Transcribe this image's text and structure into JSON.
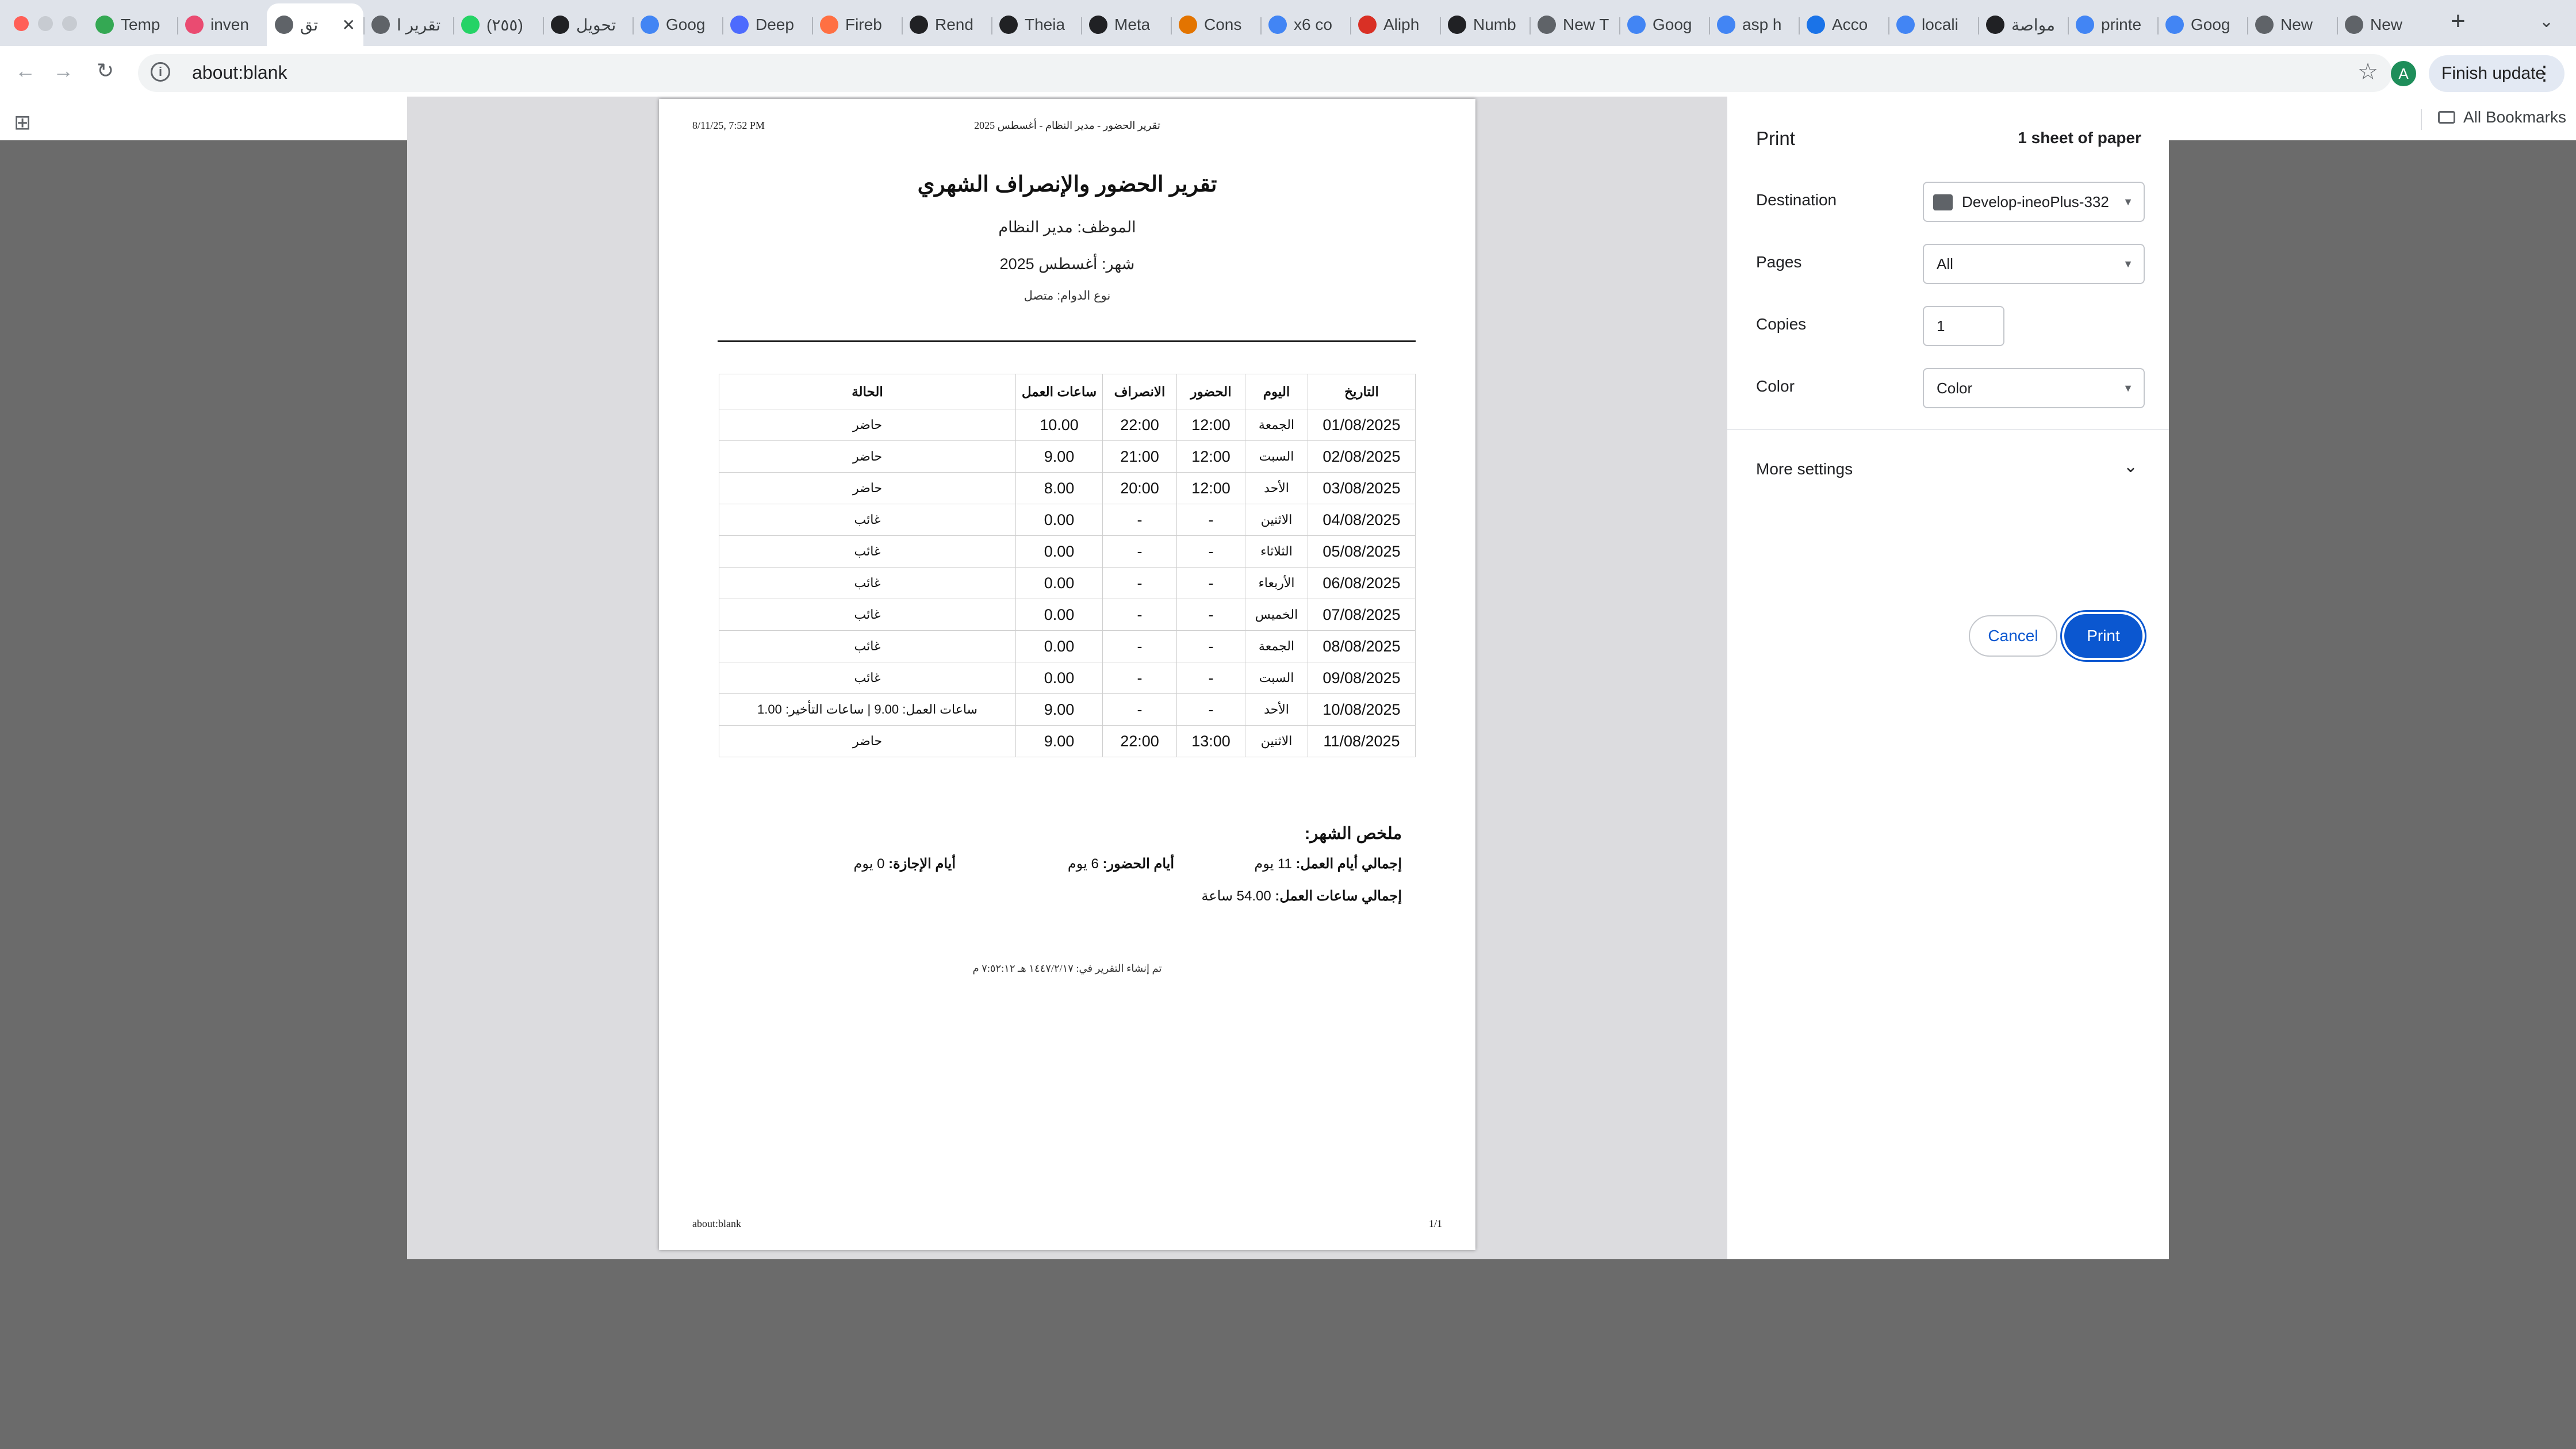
{
  "tabs": [
    {
      "label": "Temp",
      "icon": "shield-icon",
      "color": "#34a853"
    },
    {
      "label": "inven",
      "icon": "n8n-icon",
      "color": "#ea4b71"
    },
    {
      "label": "تق",
      "icon": "globe-icon",
      "color": "#5f6368",
      "active": true
    },
    {
      "label": "تقرير ا",
      "icon": "globe-icon",
      "color": "#5f6368"
    },
    {
      "label": "(٢٥٥)",
      "icon": "whatsapp-icon",
      "color": "#25d366"
    },
    {
      "label": "تحويل",
      "icon": "openai-icon",
      "color": "#202124"
    },
    {
      "label": "Goog",
      "icon": "gemini-icon",
      "color": "#4285f4"
    },
    {
      "label": "Deep",
      "icon": "deepseek-icon",
      "color": "#4d6bfe"
    },
    {
      "label": "Fireb",
      "icon": "firebase-icon",
      "color": "#ff7043"
    },
    {
      "label": "Rend",
      "icon": "render-icon",
      "color": "#202124"
    },
    {
      "label": "Theia",
      "icon": "theia-icon",
      "color": "#202124"
    },
    {
      "label": "Meta",
      "icon": "openai-icon",
      "color": "#202124"
    },
    {
      "label": "Cons",
      "icon": "console-icon",
      "color": "#e37400"
    },
    {
      "label": "x6 co",
      "icon": "google-icon",
      "color": "#4285f4"
    },
    {
      "label": "Aliph",
      "icon": "doc-icon",
      "color": "#d93025"
    },
    {
      "label": "Numb",
      "icon": "openai-icon",
      "color": "#202124"
    },
    {
      "label": "New T",
      "icon": "chrome-icon",
      "color": "#5f6368"
    },
    {
      "label": "Goog",
      "icon": "gemini-icon",
      "color": "#4285f4"
    },
    {
      "label": "asp h",
      "icon": "google-icon",
      "color": "#4285f4"
    },
    {
      "label": "Acco",
      "icon": "account-icon",
      "color": "#1a73e8"
    },
    {
      "label": "locali",
      "icon": "google-icon",
      "color": "#4285f4"
    },
    {
      "label": "مواصة",
      "icon": "openai-icon",
      "color": "#202124"
    },
    {
      "label": "printe",
      "icon": "google-icon",
      "color": "#4285f4"
    },
    {
      "label": "Goog",
      "icon": "gemini-icon",
      "color": "#4285f4"
    },
    {
      "label": "New",
      "icon": "chrome-icon",
      "color": "#5f6368"
    },
    {
      "label": "New",
      "icon": "chrome-icon",
      "color": "#5f6368"
    }
  ],
  "toolbar": {
    "url": "about:blank",
    "avatar_letter": "A",
    "finish_update": "Finish update"
  },
  "bookmarks": {
    "all_bookmarks": "All Bookmarks"
  },
  "document": {
    "header_date": "8/11/25, 7:52 PM",
    "header_title": "تقرير الحضور - مدير النظام - أغسطس 2025",
    "title": "تقرير الحضور والإنصراف الشهري",
    "employee": "الموظف: مدير النظام",
    "month": "شهر: أغسطس 2025",
    "shift_type": "نوع الدوام: متصل",
    "table_headers": {
      "date": "التاريخ",
      "day": "اليوم",
      "check_in": "الحضور",
      "check_out": "الانصراف",
      "hours": "ساعات العمل",
      "status": "الحالة"
    },
    "rows": [
      {
        "date": "01/08/2025",
        "day": "الجمعة",
        "in": "12:00",
        "out": "22:00",
        "hours": "10.00",
        "status": "حاضر",
        "status_kind": "present"
      },
      {
        "date": "02/08/2025",
        "day": "السبت",
        "in": "12:00",
        "out": "21:00",
        "hours": "9.00",
        "status": "حاضر",
        "status_kind": "present"
      },
      {
        "date": "03/08/2025",
        "day": "الأحد",
        "in": "12:00",
        "out": "20:00",
        "hours": "8.00",
        "status": "حاضر",
        "status_kind": "present"
      },
      {
        "date": "04/08/2025",
        "day": "الاثنين",
        "in": "-",
        "out": "-",
        "hours": "0.00",
        "status": "غائب",
        "status_kind": "absent"
      },
      {
        "date": "05/08/2025",
        "day": "الثلاثاء",
        "in": "-",
        "out": "-",
        "hours": "0.00",
        "status": "غائب",
        "status_kind": "absent"
      },
      {
        "date": "06/08/2025",
        "day": "الأربعاء",
        "in": "-",
        "out": "-",
        "hours": "0.00",
        "status": "غائب",
        "status_kind": "absent"
      },
      {
        "date": "07/08/2025",
        "day": "الخميس",
        "in": "-",
        "out": "-",
        "hours": "0.00",
        "status": "غائب",
        "status_kind": "absent"
      },
      {
        "date": "08/08/2025",
        "day": "الجمعة",
        "in": "-",
        "out": "-",
        "hours": "0.00",
        "status": "غائب",
        "status_kind": "absent"
      },
      {
        "date": "09/08/2025",
        "day": "السبت",
        "in": "-",
        "out": "-",
        "hours": "0.00",
        "status": "غائب",
        "status_kind": "absent"
      },
      {
        "date": "10/08/2025",
        "day": "الأحد",
        "in": "-",
        "out": "-",
        "hours": "9.00",
        "status": "ساعات العمل: 9.00 | ساعات التأخير: 1.00",
        "status_kind": "late"
      },
      {
        "date": "11/08/2025",
        "day": "الاثنين",
        "in": "13:00",
        "out": "22:00",
        "hours": "9.00",
        "status": "حاضر",
        "status_kind": "present"
      }
    ],
    "summary": {
      "title": "ملخص الشهر:",
      "total_days_label": "إجمالي أيام العمل:",
      "total_days_value": "11 يوم",
      "present_days_label": "أيام الحضور:",
      "present_days_value": "6 يوم",
      "leave_days_label": "أيام الإجازة:",
      "leave_days_value": "0 يوم",
      "total_hours_label": "إجمالي ساعات العمل:",
      "total_hours_value": "54.00 ساعة"
    },
    "generated": "تم إنشاء التقرير في: ١٤٤٧/٢/١٧ هـ ٧:٥٢:١٢ م",
    "footer_url": "about:blank",
    "footer_page": "1/1"
  },
  "print_panel": {
    "title": "Print",
    "sheets": "1 sheet of paper",
    "destination_label": "Destination",
    "destination_value": "Develop-ineoPlus-332",
    "pages_label": "Pages",
    "pages_value": "All",
    "copies_label": "Copies",
    "copies_value": "1",
    "color_label": "Color",
    "color_value": "Color",
    "more_settings": "More settings",
    "cancel": "Cancel",
    "print": "Print"
  },
  "colors": {
    "present": "#1f9d3a",
    "absent": "#d93025",
    "late": "#e3730b",
    "accent": "#0b57d0"
  }
}
